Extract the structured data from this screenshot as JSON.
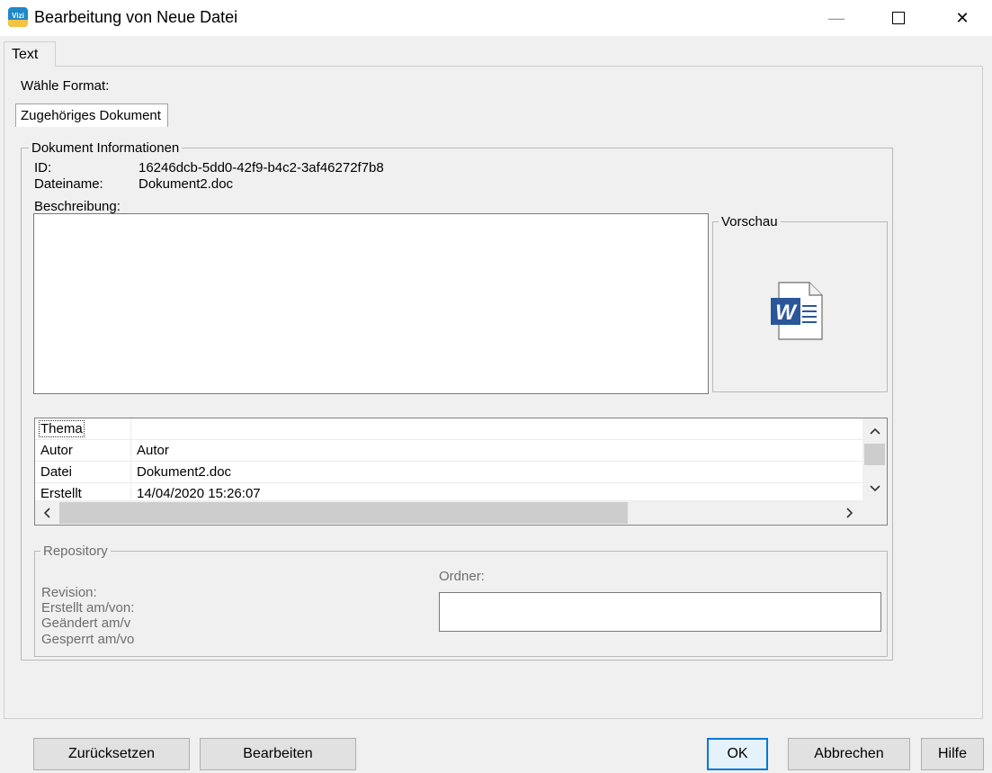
{
  "window": {
    "title": "Bearbeitung von Neue Datei",
    "app_icon_text": "Vizi",
    "minimize_glyph": "—",
    "maximize_glyph": "☐",
    "close_glyph": "✕"
  },
  "tabs": [
    {
      "label": "Text",
      "selected": true
    }
  ],
  "format": {
    "label": "Wähle Format:",
    "tab_label": "Zugehöriges Dokument"
  },
  "doc_info": {
    "legend": "Dokument Informationen",
    "id_label": "ID:",
    "id_value": "16246dcb-5dd0-42f9-b4c2-3af46272f7b8",
    "filename_label": "Dateiname:",
    "filename_value": "Dokument2.doc",
    "description_label": "Beschreibung:",
    "description_value": ""
  },
  "preview": {
    "legend": "Vorschau",
    "icon": "word-document-icon",
    "icon_letter": "W"
  },
  "properties": {
    "rows": [
      {
        "key": "Thema",
        "value": ""
      },
      {
        "key": "Autor",
        "value": "Autor"
      },
      {
        "key": "Datei",
        "value": "Dokument2.doc"
      },
      {
        "key": "Erstellt",
        "value": "14/04/2020 15:26:07"
      }
    ]
  },
  "repository": {
    "legend": "Repository",
    "revision_label": "Revision:",
    "created_label": "Erstellt am/von:",
    "changed_label": "Geändert am/v",
    "locked_label": "Gesperrt am/vo",
    "folder_label": "Ordner:",
    "folder_value": ""
  },
  "buttons": {
    "reset": "Zurücksetzen",
    "edit": "Bearbeiten",
    "ok": "OK",
    "cancel": "Abbrechen",
    "help": "Hilfe"
  },
  "colors": {
    "accent": "#0078d7",
    "word_blue": "#2b579a"
  }
}
